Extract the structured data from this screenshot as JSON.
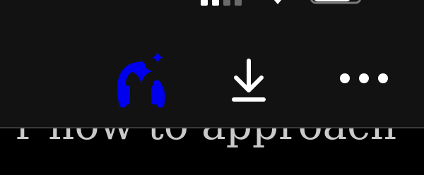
{
  "article": {
    "snippet": "r how to approach"
  },
  "toolbar": {
    "buttons": [
      {
        "name": "listen",
        "icon": "headphones-sparkle-icon",
        "color": "#0000ee"
      },
      {
        "name": "download",
        "icon": "download-icon",
        "color": "#ffffff"
      },
      {
        "name": "more",
        "icon": "more-horizontal-icon",
        "color": "#ffffff"
      }
    ]
  },
  "status_bar": {
    "icons": [
      "signal-icon",
      "wifi-icon",
      "battery-icon"
    ]
  },
  "colors": {
    "toolbar_background": "#121212",
    "page_background": "#000000",
    "accent": "#0000ee",
    "icon": "#ffffff",
    "text": "#c9c9c9"
  }
}
